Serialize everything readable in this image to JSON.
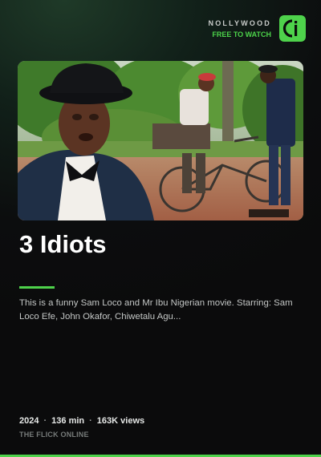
{
  "brand": {
    "name": "NOLLYWOOD",
    "tagline": "FREE TO WATCH",
    "logo_icon": "ci-logo-icon",
    "accent_color": "#4ed24b"
  },
  "movie": {
    "title": "3 Idiots",
    "description": "This is a funny Sam Loco and Mr Ibu Nigerian movie. Starring: Sam Loco Efe, John Okafor, Chiwetalu Agu...",
    "year": "2024",
    "duration": "136 min",
    "views": "163K views",
    "separator": "·",
    "source": "THE FLICK ONLINE"
  }
}
